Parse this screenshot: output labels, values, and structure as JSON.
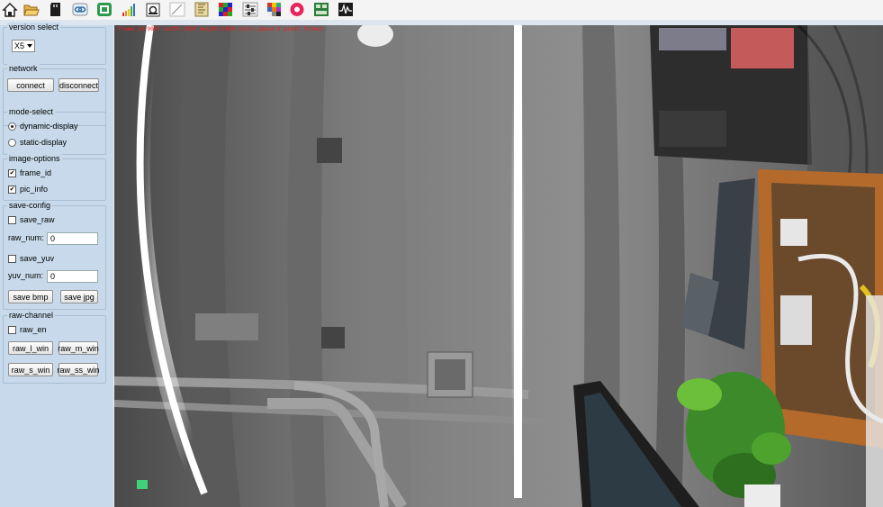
{
  "toolbar": {
    "icons": [
      "home-icon",
      "folder-open-icon",
      "sd-card-icon",
      "link-icon",
      "chip-icon",
      "signal-bars-icon",
      "camera-icon",
      "draw-icon",
      "ruler-icon",
      "color-grid-icon",
      "settings-sliders-icon",
      "colorchecker-icon",
      "record-icon",
      "layout-icon",
      "waveform-icon"
    ]
  },
  "panel": {
    "version": {
      "title": "version select",
      "selected": "X5"
    },
    "network": {
      "title": "network",
      "connect": "connect",
      "disconnect": "disconnect"
    },
    "mode": {
      "title": "mode-select",
      "dynamic": "dynamic-display",
      "static": "static-display",
      "selected": "dynamic"
    },
    "image_options": {
      "title": "image-options",
      "frame_id": "frame_id",
      "pic_info": "pic_info"
    },
    "save_config": {
      "title": "save-config",
      "save_raw": "save_raw",
      "raw_num_label": "raw_num:",
      "raw_num": "0",
      "save_yuv": "save_yuv",
      "yuv_num_label": "yuv_num:",
      "yuv_num": "0",
      "save_bmp": "save bmp",
      "save_jpg": "save jpg"
    },
    "raw_channel": {
      "title": "raw-channel",
      "raw_en": "raw_en",
      "raw_l_win": "raw_l_win",
      "raw_m_win": "raw_m_win",
      "raw_s_win": "raw_s_win",
      "raw_ss_win": "raw_ss_win"
    }
  },
  "view": {
    "overlay": "frame_id:9067 width:1920 height:1080 color_space:X pixel_format"
  }
}
